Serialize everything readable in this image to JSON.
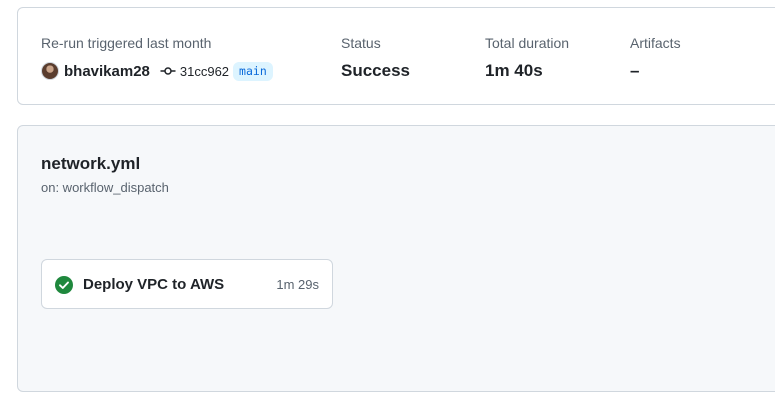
{
  "summary": {
    "trigger_label": "Re-run triggered last month",
    "actor": "bhavikam28",
    "commit_sha": "31cc962",
    "branch": "main",
    "status_label": "Status",
    "status_value": "Success",
    "duration_label": "Total duration",
    "duration_value": "1m 40s",
    "artifacts_label": "Artifacts",
    "artifacts_value": "–"
  },
  "workflow": {
    "file_name": "network.yml",
    "trigger": "on: workflow_dispatch",
    "jobs": [
      {
        "name": "Deploy VPC to AWS",
        "duration": "1m 29s",
        "status": "success"
      }
    ]
  },
  "icons": {
    "avatar": "user-avatar",
    "commit": "git-commit-icon",
    "job_status": "check-circle-fill-icon"
  },
  "colors": {
    "success": "#1f883d",
    "branch_text": "#0969da",
    "branch_bg": "#ddf4ff",
    "muted_text": "#59636e",
    "border": "#d0d7de"
  }
}
